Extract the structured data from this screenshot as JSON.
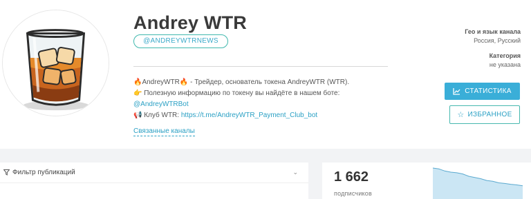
{
  "channel": {
    "title": "Andrey WTR",
    "handle": "@ANDREYWTRNEWS",
    "description": {
      "line1_text": "AndreyWTR",
      "line1_rest": " - Трейдер, основатель токена AndreyWTR (WTR).",
      "line2": "Полезную информацию по токену вы найдёте в нашем боте:",
      "line3_link": "@AndreyWTRBot",
      "line4_prefix": "Клуб WTR: ",
      "line4_link": "https://t.me/AndreyWTR_Payment_Club_bot"
    },
    "related_channels": "Связанные каналы"
  },
  "meta": {
    "geo_label": "Гео и язык канала",
    "geo_value": "Россия, Русский",
    "category_label": "Категория",
    "category_value": "не указана"
  },
  "buttons": {
    "stats": "СТАТИСТИКА",
    "favorite": "ИЗБРАННОЕ"
  },
  "filter": {
    "label": "Фильтр публикаций"
  },
  "subscribers": {
    "count": "1 662",
    "label": "подписчиков",
    "trend_values": [
      1.0,
      0.97,
      0.9,
      0.86,
      0.84,
      0.8,
      0.72,
      0.68,
      0.64,
      0.58,
      0.55,
      0.5,
      0.48,
      0.45,
      0.43,
      0.4
    ]
  },
  "colors": {
    "accent": "#3aaed8",
    "teal": "#45b8ae",
    "link": "#2aa0c4",
    "chart": "#a9d6ec"
  },
  "icons": {
    "fire": "fire-icon",
    "pointing_hand": "pointing-hand-icon",
    "megaphone": "megaphone-icon",
    "chart": "chart-icon",
    "star": "star-icon",
    "filter": "filter-icon",
    "chevron": "chevron-down-icon"
  }
}
